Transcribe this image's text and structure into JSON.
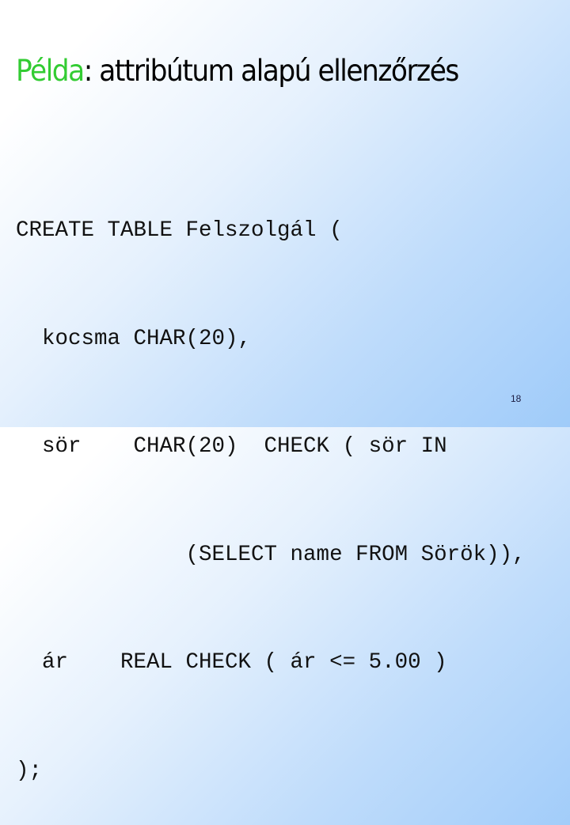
{
  "slide": {
    "title": {
      "accent": "Példa",
      "rest": ": attribútum alapú ellenzőrzés"
    },
    "colors": {
      "accent": "#33cc33",
      "background_start": "#ffffff",
      "background_end": "#9fcbf9"
    },
    "code_lines": [
      "CREATE TABLE Felszolgál (",
      "  kocsma CHAR(20),",
      "  sör    CHAR(20)  CHECK ( sör IN",
      "             (SELECT name FROM Sörök)),",
      "  ár    REAL CHECK ( ár <= 5.00 )",
      ");"
    ],
    "page_number": "18"
  }
}
